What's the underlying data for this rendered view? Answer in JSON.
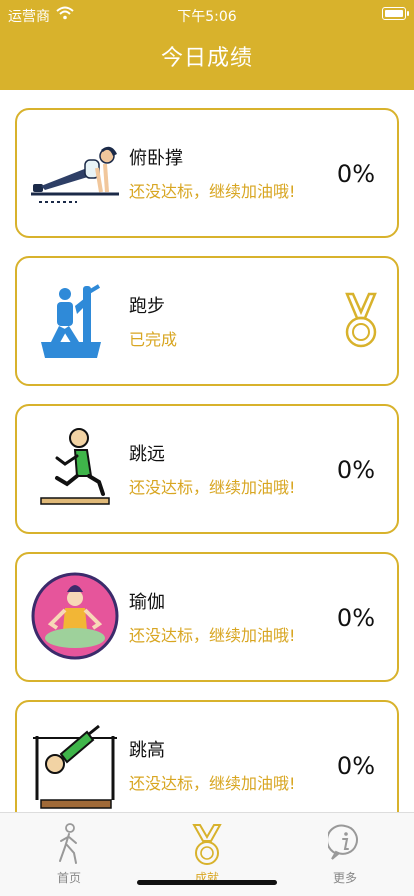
{
  "status_bar": {
    "carrier": "运营商",
    "time": "下午5:06"
  },
  "header": {
    "title": "今日成绩"
  },
  "colors": {
    "accent": "#d8b22c",
    "status_text": "#d8a622"
  },
  "activities": [
    {
      "name": "俯卧撑",
      "status": "还没达标，继续加油哦!",
      "percent": "0%",
      "icon": "pushup-icon"
    },
    {
      "name": "跑步",
      "status": "已完成",
      "icon": "running-icon",
      "badge": "medal-icon"
    },
    {
      "name": "跳远",
      "status": "还没达标，继续加油哦!",
      "percent": "0%",
      "icon": "long-jump-icon"
    },
    {
      "name": "瑜伽",
      "status": "还没达标，继续加油哦!",
      "percent": "0%",
      "icon": "yoga-icon"
    },
    {
      "name": "跳高",
      "status": "还没达标，继续加油哦!",
      "percent": "0%",
      "icon": "high-jump-icon"
    }
  ],
  "tabs": [
    {
      "label": "首页",
      "icon": "walking-person-icon"
    },
    {
      "label": "成就",
      "icon": "medal-icon",
      "active": true
    },
    {
      "label": "更多",
      "icon": "info-icon"
    }
  ]
}
